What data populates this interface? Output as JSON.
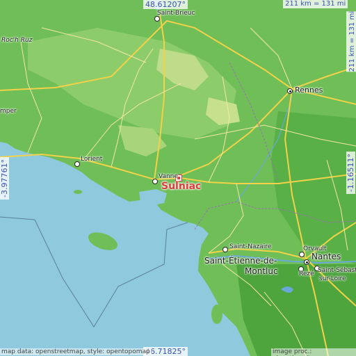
{
  "map": {
    "corner_top_lat": "48.61207°",
    "corner_bottom_lat": "46.71825°",
    "corner_left_lon": "-3.97761°",
    "corner_right_lon": "-1.16511°",
    "scale_horizontal": "211 km = 131 mi",
    "scale_vertical": "211 km = 131 mi",
    "highlight_place": "Sulniac",
    "highlight_color": "#e23a3a",
    "coord_color": "#3a4fb0"
  },
  "places": [
    {
      "id": "saint-brieuc",
      "label": "Saint-Brieuc"
    },
    {
      "id": "roch-ruz",
      "label": "Roc'h Ruz"
    },
    {
      "id": "rennes",
      "label": "Rennes"
    },
    {
      "id": "quimper",
      "label": "mper"
    },
    {
      "id": "lorient",
      "label": "Lorient"
    },
    {
      "id": "vannes",
      "label": "Vanne"
    },
    {
      "id": "saint-nazaire",
      "label": "Saint-Nazaire"
    },
    {
      "id": "saint-etienne-1",
      "label": "Saint-Étienne-de-"
    },
    {
      "id": "saint-etienne-2",
      "label": "Montluc"
    },
    {
      "id": "orvault",
      "label": "Orvault"
    },
    {
      "id": "nantes",
      "label": "Nantes"
    },
    {
      "id": "reze",
      "label": "Rezé"
    },
    {
      "id": "saint-sebastien-1",
      "label": "Saint-Sébast"
    },
    {
      "id": "saint-sebastien-2",
      "label": "sur-Loire"
    }
  ],
  "attribution": {
    "left": "map data: openstreetmap, style: opentopomap",
    "right": "image proc.: elevation.city"
  }
}
